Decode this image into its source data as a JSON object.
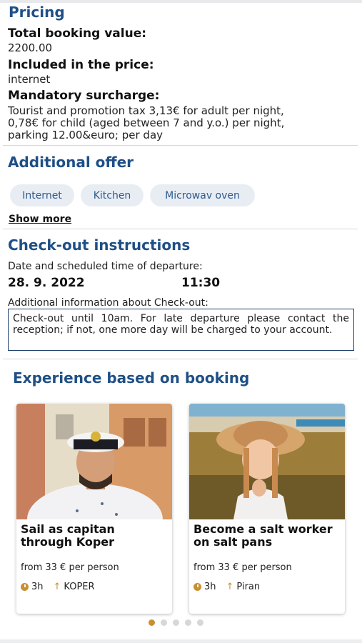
{
  "pricing": {
    "title": "Pricing",
    "total_label": "Total booking value:",
    "total_value": "2200.00",
    "included_label": "Included in the price:",
    "included_value": "internet",
    "surcharge_label": "Mandatory surcharge:",
    "surcharge_lines": [
      "Tourist and promotion tax 3,13€ for adult per night,",
      "0,78€ for child (aged between 7 and y.o.) per night,",
      "parking 12.00&euro; per day"
    ]
  },
  "additional_offer": {
    "title": "Additional offer",
    "chips": [
      "Internet",
      "Kitchen",
      "Microwav oven"
    ],
    "show_more": "Show more"
  },
  "checkout": {
    "title": "Check-out instructions",
    "date_label": "Date and scheduled time of departure:",
    "date": "28. 9. 2022",
    "time": "11:30",
    "info_label": "Additional information about Check-out:",
    "info_text": "Check-out until 10am. For late departure please contact the reception; if not, one more day will be charged to your account."
  },
  "experience": {
    "title": "Experience based on booking",
    "cards": [
      {
        "title": "Sail as capitan through Koper",
        "price": "from 33 € per person",
        "duration": "3h",
        "location": "KOPER"
      },
      {
        "title": "Become a salt worker on salt pans",
        "price": "from 33 € per person",
        "duration": "3h",
        "location": "Piran"
      }
    ],
    "carousel_dots": 5,
    "active_dot": 0
  },
  "colors": {
    "heading": "#1f4f86",
    "accent": "#c8912f",
    "chip_bg": "#e8edf4"
  }
}
